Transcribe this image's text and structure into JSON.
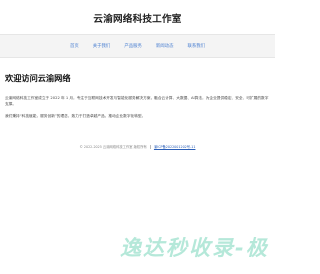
{
  "site": {
    "title": "云渝网络科技工作室"
  },
  "nav": {
    "items": [
      {
        "label": "首页"
      },
      {
        "label": "关于我们"
      },
      {
        "label": "产品服务"
      },
      {
        "label": "新闻动态"
      },
      {
        "label": "联系我们"
      }
    ]
  },
  "main": {
    "welcome_title": "欢迎访问云渝网络",
    "paragraph_1": "云渝网络科技工作室成立于 2022 年 1 月，专注于互联网技术开发与智能化服务解决方案，融合云计算、大数据、AI算法，为企业提供稳定、安全、可扩展的数字支撑。",
    "paragraph_2": "我们秉持“科技赋能，服务创新”的理念，致力于打造卓越产品，推动企业数字化转型。"
  },
  "footer": {
    "copyright": "© 2022-2025 云渝网络科技工作室 版权所有",
    "icp_link": "渝ICP备2022001202号-11"
  },
  "watermark": {
    "text": "逸达秒收录-极"
  },
  "colors": {
    "nav_link": "#4a7fd1",
    "footer_link": "#2b5fb8",
    "watermark": "#78d6ba"
  }
}
